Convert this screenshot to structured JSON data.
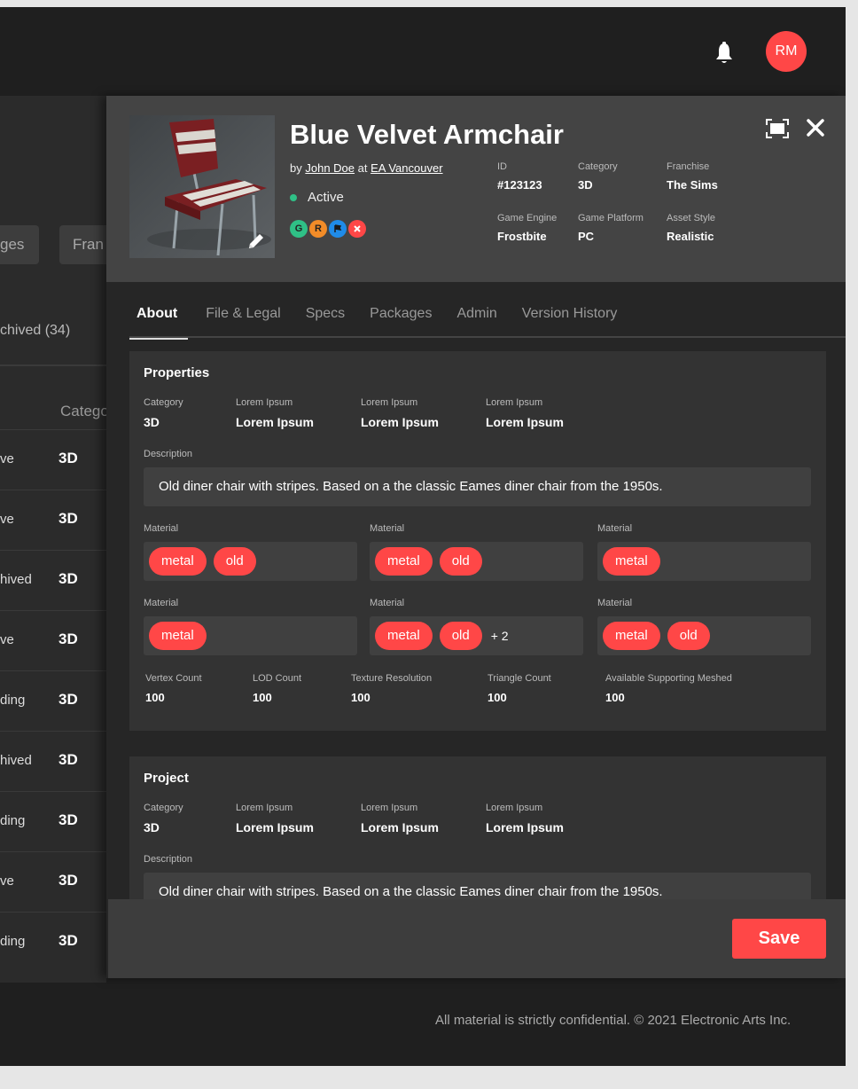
{
  "header": {
    "avatar_initials": "RM"
  },
  "background_list": {
    "buttons": [
      "ges",
      "Fran"
    ],
    "tab_label": "chived (34)",
    "column_header": "Catego",
    "rows": [
      {
        "status": "ve",
        "category": "3D"
      },
      {
        "status": "ve",
        "category": "3D"
      },
      {
        "status": "hived",
        "category": "3D"
      },
      {
        "status": "ve",
        "category": "3D"
      },
      {
        "status": "ding",
        "category": "3D"
      },
      {
        "status": "hived",
        "category": "3D"
      },
      {
        "status": "ding",
        "category": "3D"
      },
      {
        "status": "ve",
        "category": "3D"
      },
      {
        "status": "ding",
        "category": "3D"
      }
    ]
  },
  "asset": {
    "title": "Blue Velvet Armchair",
    "by_prefix": "by",
    "author": "John Doe",
    "at_word": "at",
    "studio": "EA Vancouver",
    "status": "Active",
    "badges": [
      {
        "letter": "G",
        "color": "#2fc086"
      },
      {
        "letter": "R",
        "color": "#f28c28"
      },
      {
        "letter": "",
        "color": "#1f8be8",
        "icon": "flag-icon"
      },
      {
        "letter": "",
        "color": "#ff4747",
        "icon": "x-icon"
      }
    ],
    "meta": [
      {
        "label": "ID",
        "value": "#123123"
      },
      {
        "label": "Category",
        "value": "3D"
      },
      {
        "label": "Franchise",
        "value": "The Sims"
      },
      {
        "label": "Game Engine",
        "value": "Frostbite"
      },
      {
        "label": "Game Platform",
        "value": "PC"
      },
      {
        "label": "Asset Style",
        "value": "Realistic"
      }
    ]
  },
  "tabs": [
    "About",
    "File & Legal",
    "Specs",
    "Packages",
    "Admin",
    "Version History"
  ],
  "properties": {
    "title": "Properties",
    "fields": [
      {
        "label": "Category",
        "value": "3D"
      },
      {
        "label": "Lorem Ipsum",
        "value": "Lorem Ipsum"
      },
      {
        "label": "Lorem Ipsum",
        "value": "Lorem Ipsum"
      },
      {
        "label": "Lorem Ipsum",
        "value": "Lorem Ipsum"
      }
    ],
    "description_label": "Description",
    "description": "Old diner chair with stripes. Based on a the classic Eames diner chair from the 1950s.",
    "materials": [
      {
        "label": "Material",
        "tags": [
          "metal",
          "old"
        ],
        "more": ""
      },
      {
        "label": "Material",
        "tags": [
          "metal",
          "old"
        ],
        "more": ""
      },
      {
        "label": "Material",
        "tags": [
          "metal"
        ],
        "more": ""
      },
      {
        "label": "Material",
        "tags": [
          "metal"
        ],
        "more": ""
      },
      {
        "label": "Material",
        "tags": [
          "metal",
          "old"
        ],
        "more": "+ 2"
      },
      {
        "label": "Material",
        "tags": [
          "metal",
          "old"
        ],
        "more": ""
      }
    ],
    "counts": [
      {
        "label": "Vertex Count",
        "value": "100"
      },
      {
        "label": "LOD Count",
        "value": "100"
      },
      {
        "label": "Texture Resolution",
        "value": "100"
      },
      {
        "label": "Triangle Count",
        "value": "100"
      },
      {
        "label": "Available Supporting Meshed",
        "value": "100"
      }
    ]
  },
  "project": {
    "title": "Project",
    "fields": [
      {
        "label": "Category",
        "value": "3D"
      },
      {
        "label": "Lorem Ipsum",
        "value": "Lorem Ipsum"
      },
      {
        "label": "Lorem Ipsum",
        "value": "Lorem Ipsum"
      },
      {
        "label": "Lorem Ipsum",
        "value": "Lorem Ipsum"
      }
    ],
    "description_label": "Description",
    "description": "Old diner chair with stripes. Based on a the classic Eames diner chair from the 1950s."
  },
  "save_label": "Save",
  "footer": {
    "copyright": "All material is strictly confidential. © 2021 Electronic Arts Inc."
  },
  "colors": {
    "accent": "#ff4747",
    "active": "#2fc086",
    "panel": "#262626",
    "header": "#444444"
  }
}
